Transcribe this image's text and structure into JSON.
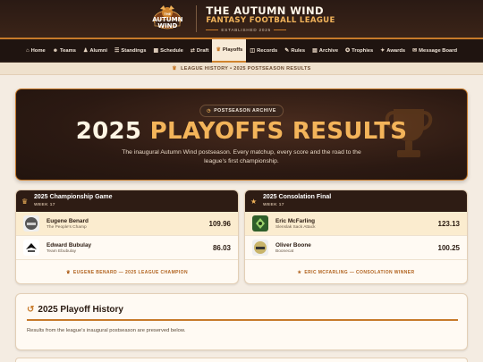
{
  "brand": {
    "logo_text": [
      "THE",
      "AUTUMN",
      "WIND"
    ],
    "title": "THE AUTUMN WIND",
    "subtitle": "FANTASY FOOTBALL LEAGUE",
    "established": "ESTABLISHED 2025"
  },
  "nav": {
    "items": [
      {
        "label": "Home",
        "icon": "home-icon"
      },
      {
        "label": "Teams",
        "icon": "teams-icon"
      },
      {
        "label": "Alumni",
        "icon": "alumni-icon"
      },
      {
        "label": "Standings",
        "icon": "standings-icon"
      },
      {
        "label": "Schedule",
        "icon": "schedule-icon"
      },
      {
        "label": "Draft",
        "icon": "draft-icon"
      },
      {
        "label": "Playoffs",
        "icon": "trophy-icon",
        "active": true
      },
      {
        "label": "Records",
        "icon": "records-icon"
      },
      {
        "label": "Rules",
        "icon": "rules-icon"
      },
      {
        "label": "Archive",
        "icon": "archive-icon"
      },
      {
        "label": "Trophies",
        "icon": "trophies-icon"
      },
      {
        "label": "Awards",
        "icon": "awards-icon"
      },
      {
        "label": "Message Board",
        "icon": "message-icon"
      }
    ]
  },
  "breadcrumb": "LEAGUE HISTORY • 2025 POSTSEASON RESULTS",
  "hero": {
    "pill": "POSTSEASON ARCHIVE",
    "title_year": "2025 ",
    "title_rest": "PLAYOFFS RESULTS",
    "description": "The inaugural Autumn Wind postseason. Every matchup, every score and the road to the league's first championship."
  },
  "championship": {
    "title": "2025 Championship Game",
    "week": "WEEK 17",
    "teams": [
      {
        "name": "Eugene Benard",
        "team": "The People's Champ",
        "score": "109.96",
        "winner": true
      },
      {
        "name": "Edward Bubulay",
        "team": "Team Ebubulay",
        "score": "86.03",
        "winner": false
      }
    ],
    "footer": "EUGENE BENARD — 2025 LEAGUE CHAMPION"
  },
  "consolation": {
    "title": "2025 Consolation Final",
    "week": "WEEK 17",
    "teams": [
      {
        "name": "Eric McFarling",
        "team": "Slenslak Sack Attack",
        "score": "123.13",
        "winner": true
      },
      {
        "name": "Oliver Boone",
        "team": "Boonecat",
        "score": "100.25",
        "winner": false
      }
    ],
    "footer": "ERIC MCFARLING — CONSOLATION WINNER"
  },
  "history": {
    "title": "2025 Playoff History",
    "text": "Results from the league's inaugural postseason are preserved below."
  },
  "colors": {
    "accent": "#c77a2a",
    "dark": "#2a1a14",
    "gold": "#f0b25a",
    "cream": "#fffaf3"
  }
}
